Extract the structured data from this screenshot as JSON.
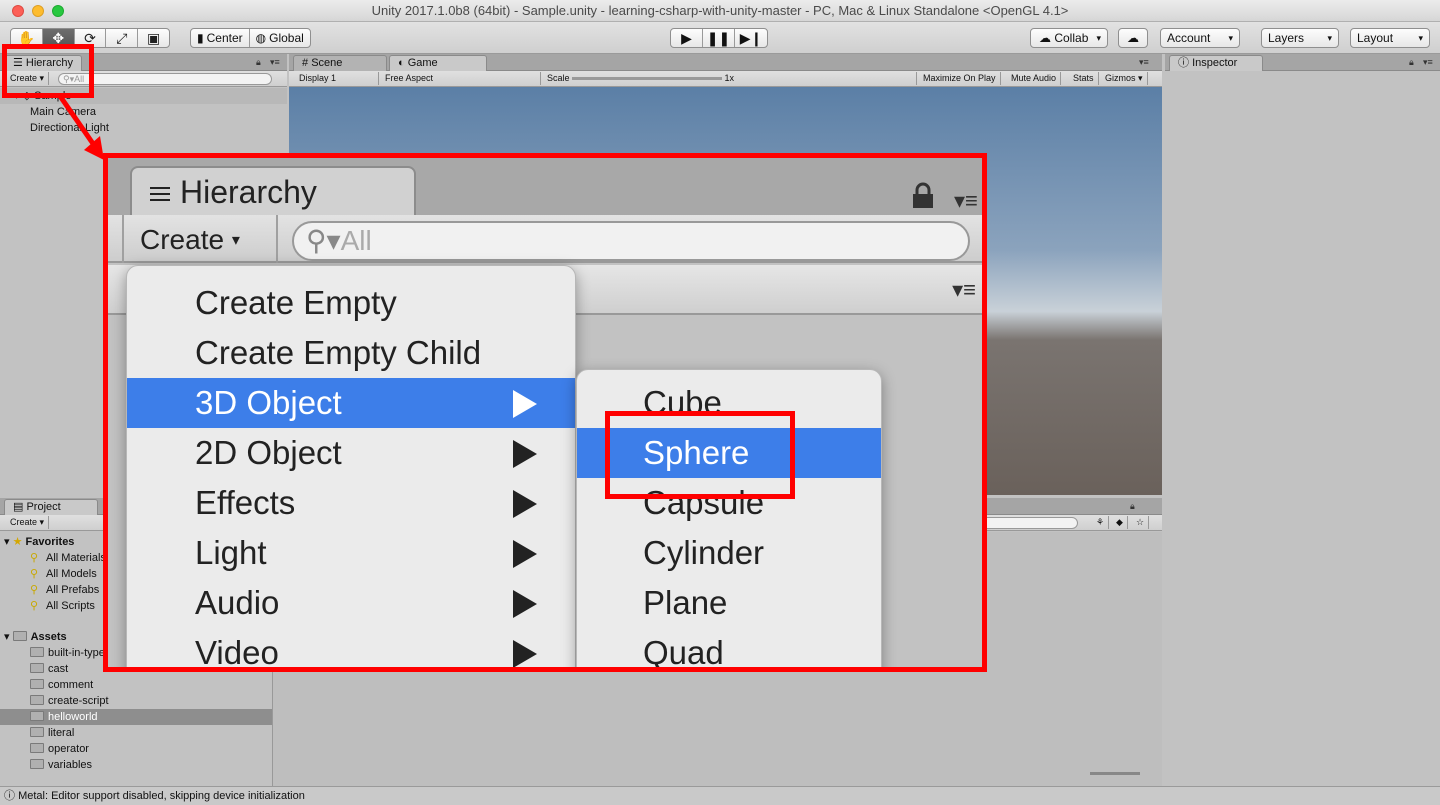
{
  "window": {
    "title": "Unity 2017.1.0b8 (64bit) - Sample.unity - learning-csharp-with-unity-master - PC, Mac & Linux Standalone <OpenGL 4.1>"
  },
  "toolbar": {
    "tool_icons": [
      "hand-icon",
      "move-icon",
      "rotate-icon",
      "scale-icon",
      "rect-icon"
    ],
    "center_label": "Center",
    "global_label": "Global",
    "play_icons": [
      "play-icon",
      "pause-icon",
      "step-icon"
    ],
    "collab_label": "Collab",
    "account_label": "Account",
    "layers_label": "Layers",
    "layout_label": "Layout"
  },
  "hierarchy": {
    "tab": "Hierarchy",
    "create": "Create",
    "search_placeholder": "All",
    "scene": "Sample",
    "items": [
      "Main Camera",
      "Directional Light"
    ]
  },
  "sceneview": {
    "tab_scene": "Scene",
    "tab_game": "Game",
    "display": "Display 1",
    "aspect": "Free Aspect",
    "scale_label": "Scale",
    "scale_value": "1x",
    "maximize": "Maximize On Play",
    "mute": "Mute Audio",
    "stats": "Stats",
    "gizmos": "Gizmos"
  },
  "inspector": {
    "tab": "Inspector"
  },
  "project": {
    "tab": "Project",
    "create": "Create",
    "favorites_label": "Favorites",
    "favorites": [
      "All Materials",
      "All Models",
      "All Prefabs",
      "All Scripts"
    ],
    "assets_label": "Assets",
    "assets": [
      "built-in-types",
      "cast",
      "comment",
      "create-script",
      "helloworld",
      "literal",
      "operator",
      "variables"
    ],
    "selected_asset": "helloworld"
  },
  "zoom": {
    "tab": "Hierarchy",
    "create": "Create",
    "search": "All",
    "menu": [
      {
        "label": "Create Empty",
        "submenu": false
      },
      {
        "label": "Create Empty Child",
        "submenu": false
      },
      {
        "label": "3D Object",
        "submenu": true
      },
      {
        "label": "2D Object",
        "submenu": true
      },
      {
        "label": "Effects",
        "submenu": true
      },
      {
        "label": "Light",
        "submenu": true
      },
      {
        "label": "Audio",
        "submenu": true
      },
      {
        "label": "Video",
        "submenu": true
      }
    ],
    "selected_menu": "3D Object",
    "submenu": [
      "Cube",
      "Sphere",
      "Capsule",
      "Cylinder",
      "Plane",
      "Quad"
    ],
    "selected_submenu": "Sphere"
  },
  "status": {
    "message": "Metal: Editor support disabled, skipping device initialization"
  },
  "colors": {
    "highlight": "#ff0000",
    "selection": "#3d7ee9",
    "editor_bg": "#c2c2c2"
  }
}
